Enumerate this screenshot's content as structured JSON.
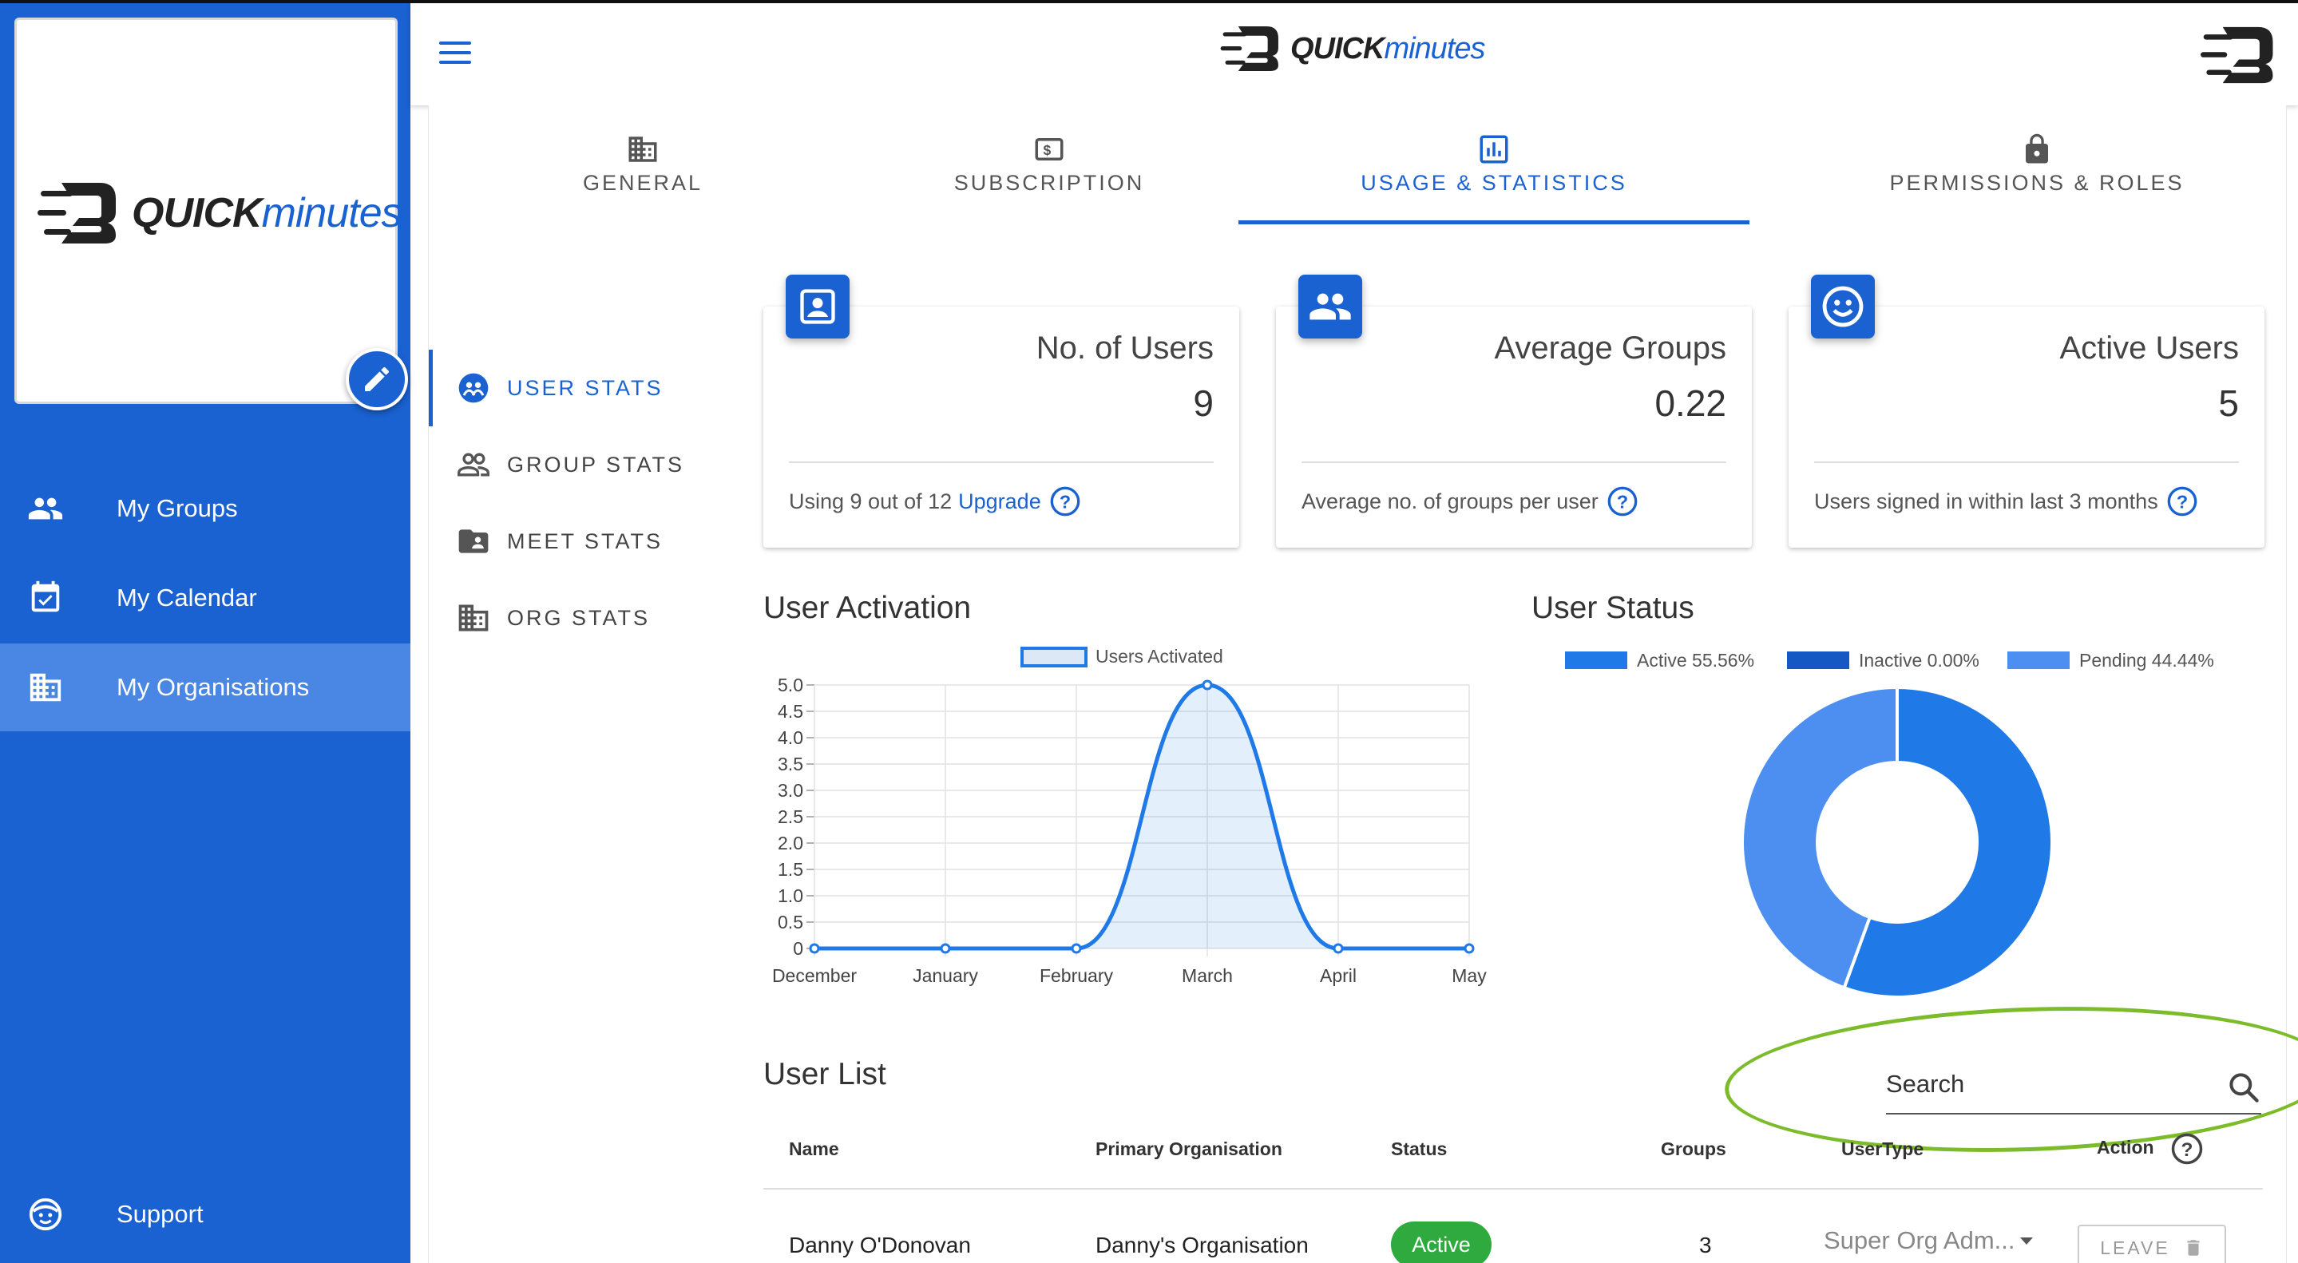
{
  "brand": {
    "word_quick": "QUICK",
    "word_minutes": "minutes"
  },
  "sidebar": {
    "items": [
      {
        "label": "My Groups",
        "icon": "people-icon"
      },
      {
        "label": "My Calendar",
        "icon": "calendar-check-icon"
      },
      {
        "label": "My Organisations",
        "icon": "building-icon",
        "active": true
      },
      {
        "label": "Support",
        "icon": "smile-icon"
      }
    ]
  },
  "tabs": [
    {
      "label": "GENERAL",
      "icon": "building-icon"
    },
    {
      "label": "SUBSCRIPTION",
      "icon": "dollar-icon"
    },
    {
      "label": "USAGE & STATISTICS",
      "icon": "bar-chart-icon",
      "active": true
    },
    {
      "label": "PERMISSIONS & ROLES",
      "icon": "lock-icon"
    }
  ],
  "subnav": [
    {
      "label": "USER STATS",
      "icon": "face-group-icon",
      "active": true
    },
    {
      "label": "GROUP STATS",
      "icon": "people-outline-icon"
    },
    {
      "label": "MEET STATS",
      "icon": "folder-user-icon"
    },
    {
      "label": "ORG STATS",
      "icon": "building-icon"
    }
  ],
  "cards": [
    {
      "title": "No. of Users",
      "value": "9",
      "footer": "Using 9 out of 12",
      "link": "Upgrade",
      "icon": "account-box-icon"
    },
    {
      "title": "Average Groups",
      "value": "0.22",
      "footer": "Average no. of groups per user",
      "icon": "group-icon"
    },
    {
      "title": "Active Users",
      "value": "5",
      "footer": "Users signed in within last 3 months",
      "icon": "smiley-icon"
    }
  ],
  "sections": {
    "user_activation": "User Activation",
    "user_status": "User Status",
    "user_list": "User List"
  },
  "colors": {
    "primary": "#1a62d2",
    "sidebar_active": "#4a86e4",
    "active_chip": "#2eaa3e",
    "annotation_oval": "#7cbb2a"
  },
  "chart_data": [
    {
      "type": "line",
      "legend": [
        "Users Activated"
      ],
      "legend_position": "top",
      "categories": [
        "December",
        "January",
        "February",
        "March",
        "April",
        "May"
      ],
      "series": [
        {
          "name": "Users Activated",
          "values": [
            0,
            0,
            0,
            5,
            0,
            0
          ]
        }
      ],
      "ylim": [
        0,
        5
      ],
      "yticks": [
        "5.0",
        "4.5",
        "4.0",
        "3.5",
        "3.0",
        "2.5",
        "2.0",
        "1.5",
        "1.0",
        "0.5",
        "0"
      ],
      "grid": true
    },
    {
      "type": "pie",
      "legend_position": "top",
      "labels": [
        "Active 55.56%",
        "Inactive 0.00%",
        "Pending 44.44%"
      ],
      "values": [
        55.56,
        0,
        44.44
      ],
      "colors": [
        "#1f7ae8",
        "#1558c4",
        "#4d8ff0"
      ]
    }
  ],
  "user_list": {
    "search_placeholder": "Search",
    "columns": [
      "Name",
      "Primary Organisation",
      "Status",
      "Groups",
      "UserType",
      "Action"
    ],
    "rows": [
      {
        "name": "Danny O'Donovan",
        "org": "Danny's Organisation",
        "status": "Active",
        "groups": "3",
        "usertype": "Super Org Adm...",
        "action": "LEAVE"
      }
    ]
  }
}
